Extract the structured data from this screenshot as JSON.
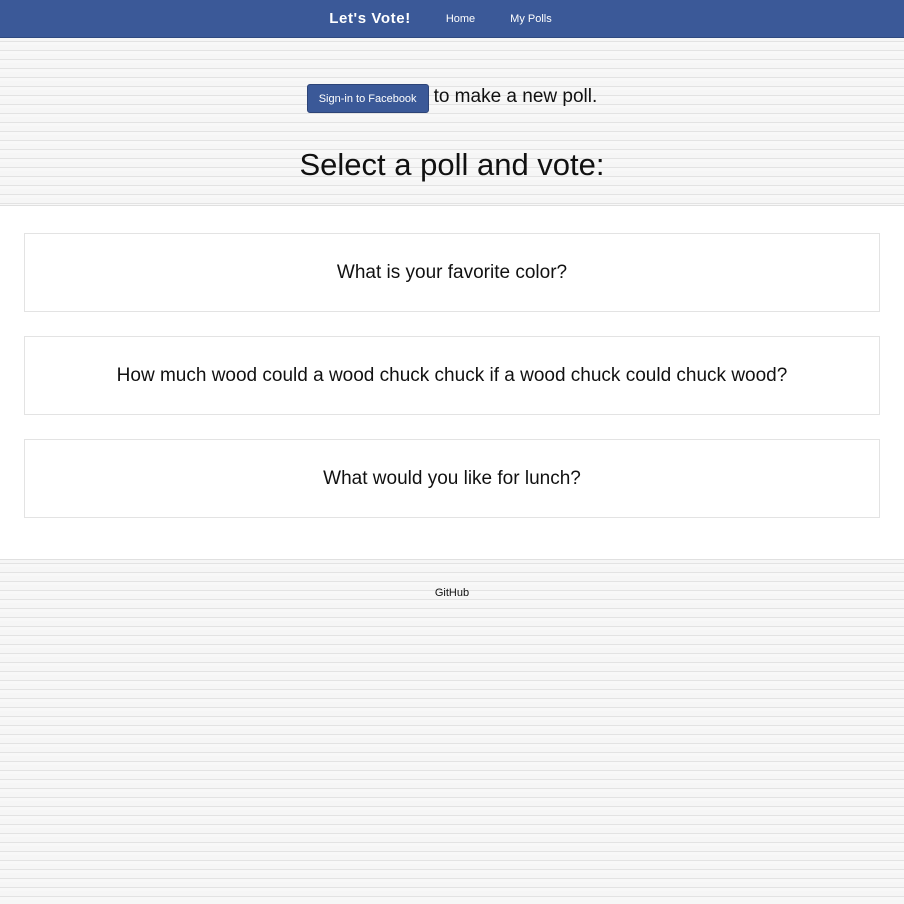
{
  "navbar": {
    "brand": "Let's Vote!",
    "links": [
      "Home",
      "My Polls"
    ],
    "color": "#3b5998"
  },
  "signin": {
    "button_label": "Sign-in to Facebook",
    "trailing_text": "to make a new poll."
  },
  "main": {
    "heading": "Select a poll and vote:",
    "polls": [
      "What is your favorite color?",
      "How much wood could a wood chuck chuck if a wood chuck could chuck wood?",
      "What would you like for lunch?"
    ]
  },
  "footer": {
    "link": "GitHub"
  }
}
